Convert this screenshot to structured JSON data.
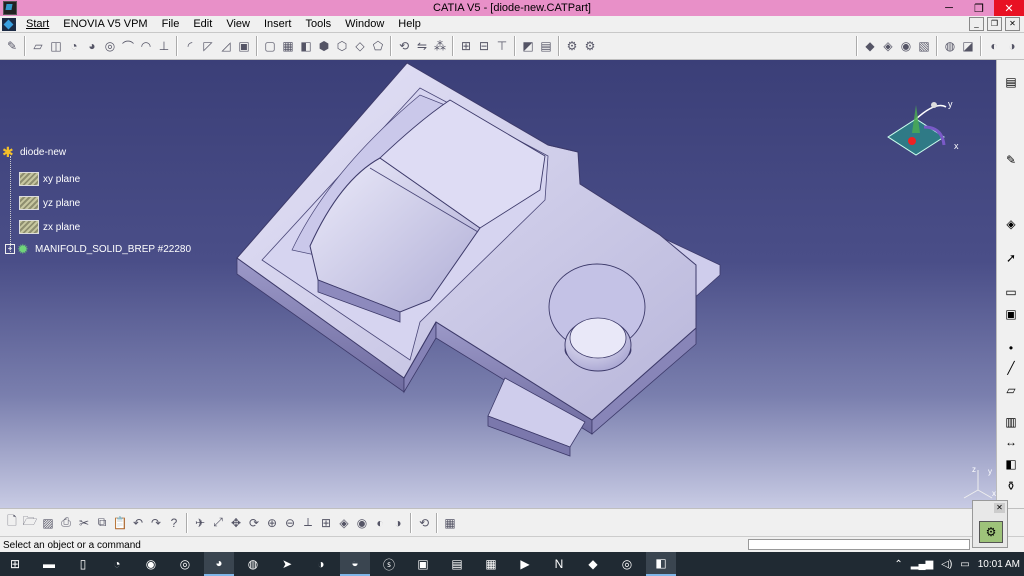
{
  "window": {
    "title": "CATIA V5 - [diode-new.CATPart]",
    "minimize": "─",
    "maximize": "❐",
    "close": "✕"
  },
  "menubar": {
    "items": [
      "Start",
      "ENOVIA V5 VPM",
      "File",
      "Edit",
      "View",
      "Insert",
      "Tools",
      "Window",
      "Help"
    ]
  },
  "tree": {
    "root": "diode-new",
    "planes": [
      "xy plane",
      "yz plane",
      "zx plane"
    ],
    "body": "MANIFOLD_SOLID_BREP #22280"
  },
  "compass": {
    "x_label": "x",
    "y_label": "y"
  },
  "triad": {
    "x_label": "x",
    "y_label": "y",
    "z_label": "z"
  },
  "statusbar": {
    "message": "Select an object or a command"
  },
  "taskbar": {
    "time": "10:01 AM"
  }
}
